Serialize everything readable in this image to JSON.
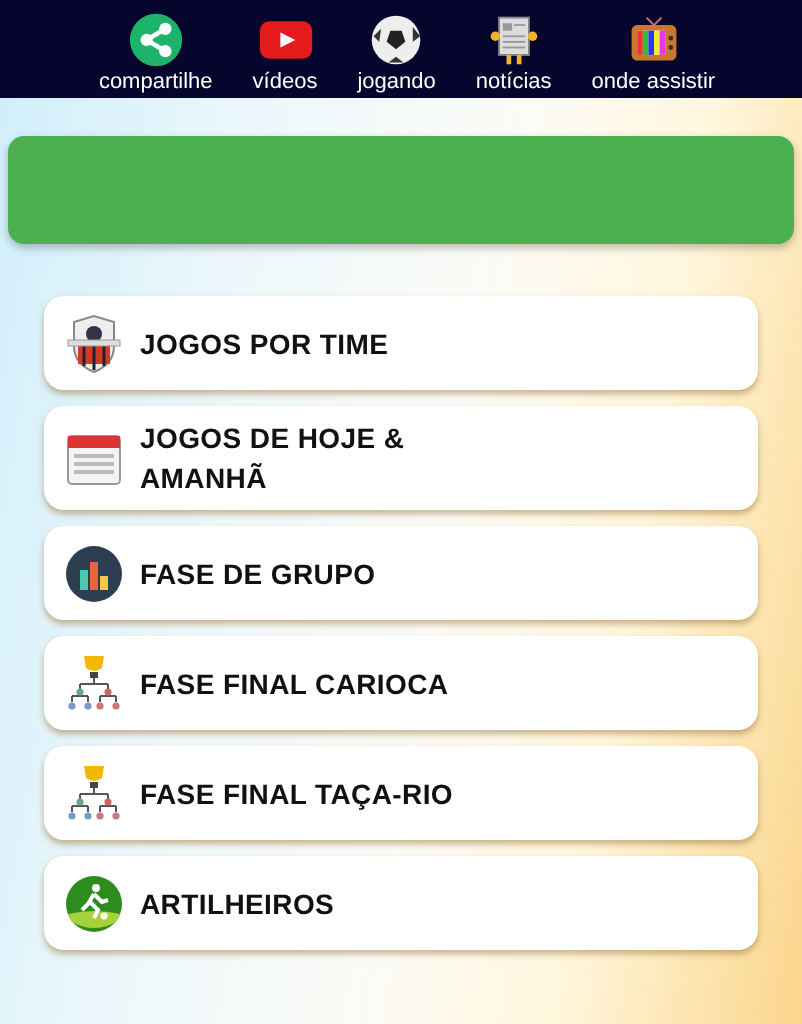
{
  "top_nav": [
    {
      "kind": "share",
      "label": "compartilhe"
    },
    {
      "kind": "video",
      "label": "vídeos"
    },
    {
      "kind": "ball",
      "label": "jogando"
    },
    {
      "kind": "news",
      "label": "notícias"
    },
    {
      "kind": "tv",
      "label": "onde assistir"
    }
  ],
  "menu": [
    {
      "kind": "crest",
      "label": "JOGOS POR TIME"
    },
    {
      "kind": "calendar",
      "label": "JOGOS DE HOJE & AMANHÃ"
    },
    {
      "kind": "podium",
      "label": "FASE DE GRUPO"
    },
    {
      "kind": "bracket",
      "label": "FASE FINAL CARIOCA"
    },
    {
      "kind": "bracket",
      "label": "FASE FINAL TAÇA-RIO"
    },
    {
      "kind": "player",
      "label": "ARTILHEIROS"
    }
  ]
}
